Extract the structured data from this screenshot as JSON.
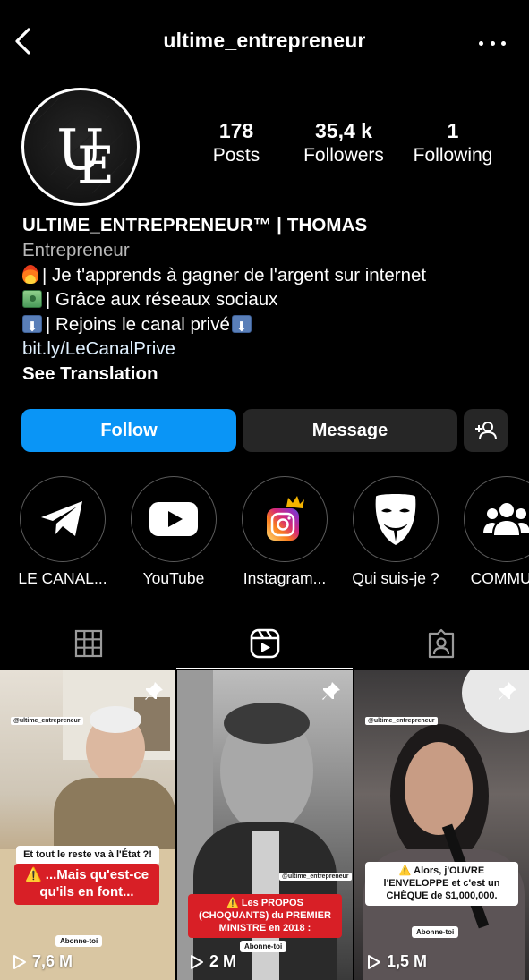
{
  "header": {
    "username": "ultime_entrepreneur"
  },
  "profile": {
    "avatar_text": "UE",
    "stats": {
      "posts_value": "178",
      "posts_label": "Posts",
      "followers_value": "35,4 k",
      "followers_label": "Followers",
      "following_value": "1",
      "following_label": "Following"
    },
    "bio": {
      "display_name": "ULTIME_ENTREPRENEUR™ | THOMAS",
      "category": "Entrepreneur",
      "line1": "| Je t'apprends à gagner de l'argent sur internet",
      "line2": "| Grâce aux réseaux sociaux",
      "line3": "| Rejoins le canal privé",
      "link": "bit.ly/LeCanalPrive",
      "see_translation": "See Translation"
    }
  },
  "actions": {
    "follow_label": "Follow",
    "message_label": "Message"
  },
  "highlights": [
    {
      "label": "LE CANAL...",
      "icon": "telegram-icon"
    },
    {
      "label": "YouTube",
      "icon": "youtube-icon"
    },
    {
      "label": "Instagram...",
      "icon": "instagram-icon"
    },
    {
      "label": "Qui suis-je ?",
      "icon": "anonymous-mask-icon"
    },
    {
      "label": "COMMUN",
      "icon": "community-icon"
    }
  ],
  "tabs": [
    {
      "name": "grid",
      "icon": "grid-icon"
    },
    {
      "name": "reels",
      "icon": "reels-icon",
      "active": true
    },
    {
      "name": "tagged",
      "icon": "tagged-icon"
    }
  ],
  "reels": [
    {
      "views": "7,6 M",
      "handle": "@ultime_entrepreneur",
      "caption_top": "Et tout le reste va à l'État ?!",
      "caption_main": "⚠️ ...Mais qu'est-ce qu'ils en font...",
      "subscribe": "Abonne-toi"
    },
    {
      "views": "2 M",
      "handle": "@ultime_entrepreneur",
      "caption_main": "⚠️ Les PROPOS (CHOQUANTS) du PREMIER MINISTRE en 2018 :",
      "subscribe": "Abonne-toi"
    },
    {
      "views": "1,5 M",
      "handle": "@ultime_entrepreneur",
      "caption_main": "⚠️ Alors, j'OUVRE l'ENVELOPPE et c'est un CHÈQUE de $1,000,000.",
      "subscribe": "Abonne-toi"
    }
  ],
  "colors": {
    "background": "#000000",
    "follow_button": "#0A95F6",
    "secondary_button": "#262626",
    "link": "#E0F1FF"
  }
}
